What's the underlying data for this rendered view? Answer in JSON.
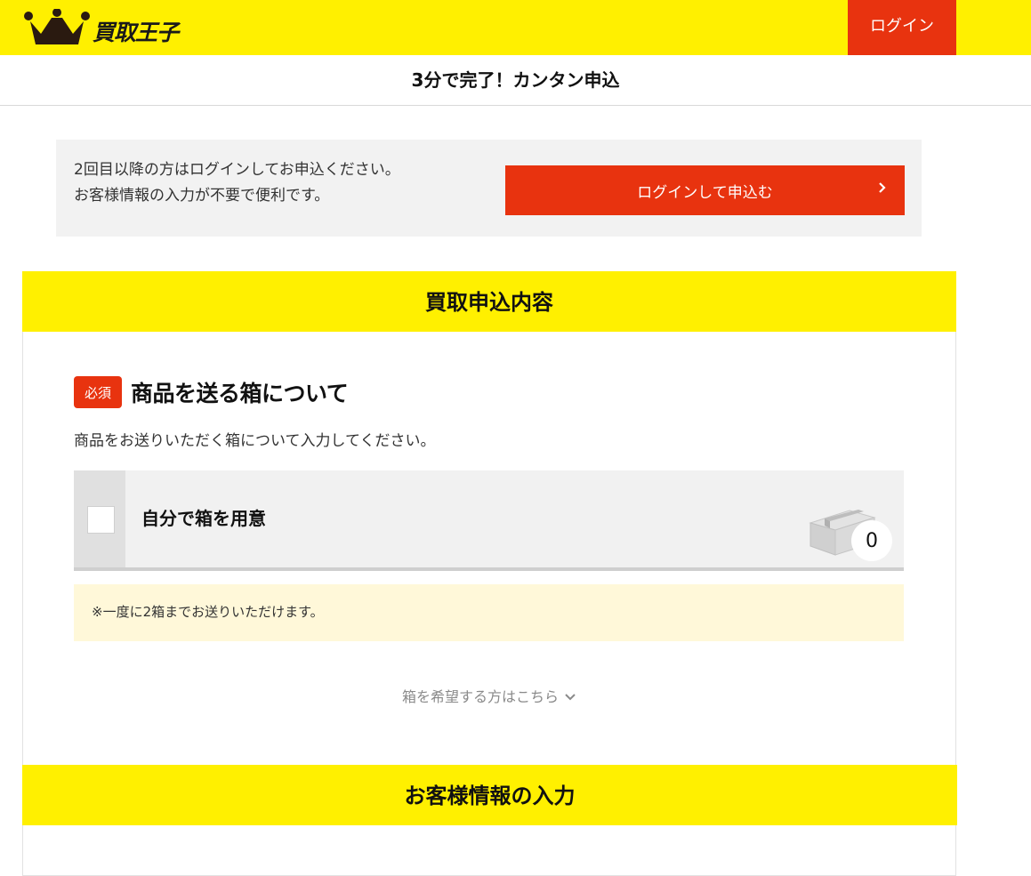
{
  "header": {
    "logo_text": "買取王子",
    "login_label": "ログイン",
    "colors": {
      "brand_yellow": "#fff000",
      "accent_red": "#e8330f"
    }
  },
  "title": "3分で完了！カンタン申込",
  "login_prompt": {
    "line1": "2回目以降の方はログインしてお申込ください。",
    "line2": "お客様情報の入力が不要で便利です。",
    "button_label": "ログインして申込む",
    "button_icon": "chevron-right-icon"
  },
  "section1": {
    "heading": "買取申込内容",
    "required_badge": "必須",
    "subtitle": "商品を送る箱について",
    "description": "商品をお送りいただく箱について入力してください。",
    "option": {
      "label": "自分で箱を用意",
      "checked": false,
      "icon": "box-icon",
      "count": "0"
    },
    "note": "※一度に2箱までお送りいただけます。",
    "more_link": "箱を希望する方はこちら",
    "more_link_icon": "chevron-down-icon"
  },
  "section2": {
    "heading": "お客様情報の入力"
  }
}
